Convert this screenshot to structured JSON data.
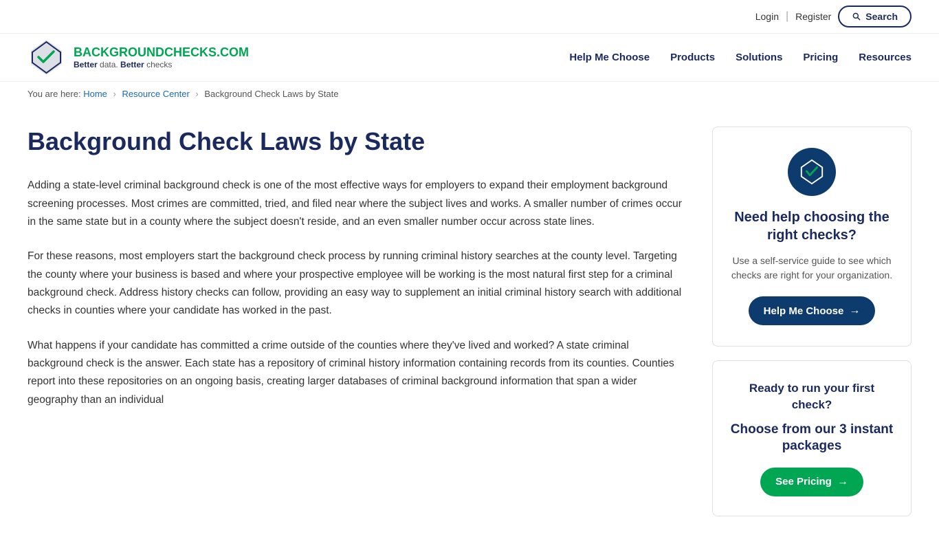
{
  "topbar": {
    "login_label": "Login",
    "register_label": "Register",
    "search_label": "Search"
  },
  "nav": {
    "logo_brand_part1": "BACKGROUND",
    "logo_brand_part2": "CHECKS.COM",
    "logo_tagline_part1": "Better",
    "logo_tagline_text1": " data. ",
    "logo_tagline_part2": "Better",
    "logo_tagline_text2": " checks",
    "links": [
      {
        "label": "Help Me Choose",
        "href": "#"
      },
      {
        "label": "Products",
        "href": "#"
      },
      {
        "label": "Solutions",
        "href": "#"
      },
      {
        "label": "Pricing",
        "href": "#"
      },
      {
        "label": "Resources",
        "href": "#"
      }
    ]
  },
  "breadcrumb": {
    "prefix": "You are here:",
    "home_label": "Home",
    "resource_center_label": "Resource Center",
    "current_label": "Background Check Laws by State"
  },
  "main": {
    "title": "Background Check Laws by State",
    "paragraphs": [
      "Adding a state-level criminal background check is one of the most effective ways for employers to expand their employment background screening processes. Most crimes are committed, tried, and filed near where the subject lives and works. A smaller number of crimes occur in the same state but in a county where the subject doesn't reside, and an even smaller number occur across state lines.",
      "For these reasons, most employers start the background check process by running criminal history searches at the county level. Targeting the county where your business is based and where your prospective employee will be working is the most natural first step for a criminal background check. Address history checks can follow, providing an easy way to supplement an initial criminal history search with additional checks in counties where your candidate has worked in the past.",
      "What happens if your candidate has committed a crime outside of the counties where they've lived and worked? A state criminal background check is the answer. Each state has a repository of criminal history information containing records from its counties. Counties report into these repositories on an ongoing basis, creating larger databases of criminal background information that span a wider geography than an individual"
    ]
  },
  "sidebar": {
    "card1": {
      "title": "Need help choosing the right checks?",
      "description": "Use a self-service guide to see which checks are right for your organization.",
      "btn_label": "Help Me Choose"
    },
    "card2": {
      "title": "Ready to run your first check?",
      "subtitle": "Choose from our 3 instant packages",
      "btn_label": "See Pricing"
    }
  }
}
